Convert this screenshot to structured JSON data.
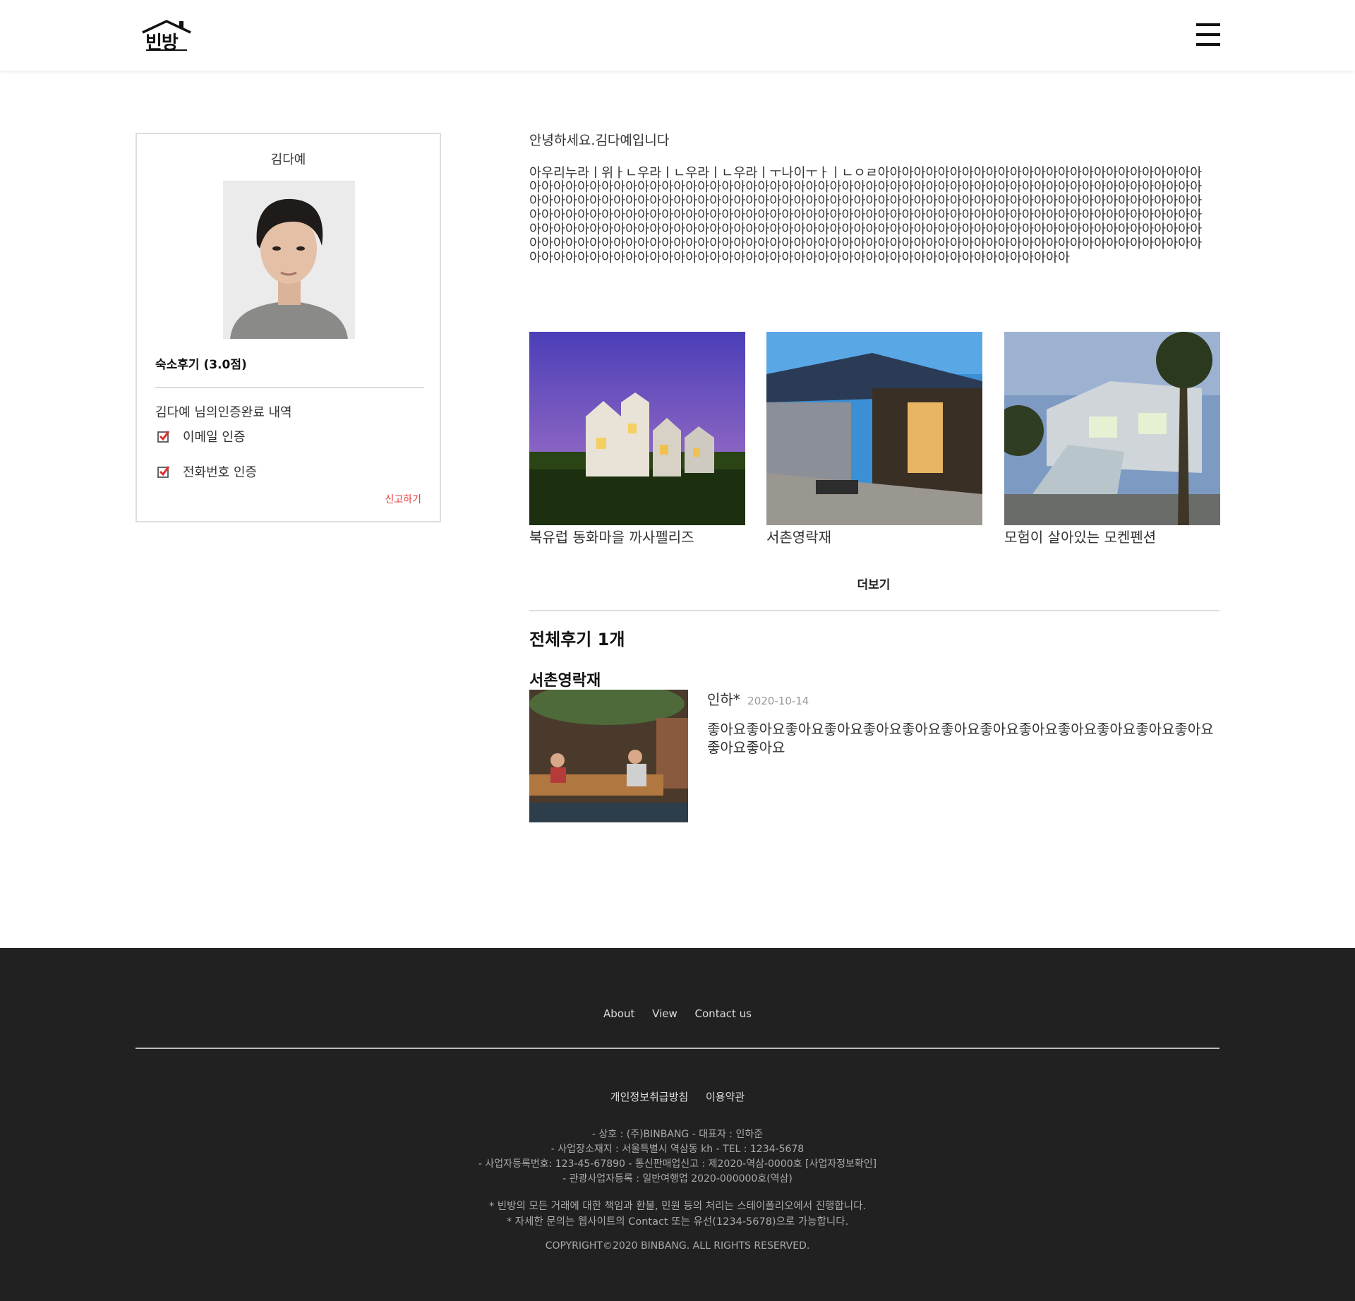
{
  "header": {
    "logo_text": "빈방"
  },
  "profile": {
    "name": "김다예",
    "review_score": "숙소후기 (3.0점)",
    "verify_title": "김다예 님의인증완료 내역",
    "verifications": [
      {
        "label": "이메일 인증",
        "icon": "checkbox-checked-icon"
      },
      {
        "label": "전화번호 인증",
        "icon": "checkbox-checked-icon"
      }
    ],
    "report_label": "신고하기"
  },
  "intro": {
    "greeting": "안녕하세요.김다예입니다",
    "body": "아우리누라ㅣ위ㅏㄴ우라ㅣㄴ우라ㅣㄴ우라ㅣㅜ나이ㅜㅏㅣㄴㅇㄹ아아아아아아아아아아아아아아아아아아아아아아아아아아아아아아아아아아아아아아아아아아아아아아아아아아아아아아아아아아아아아아아아아아아아아아아아아아아아아아아아아아아아아아아아아아아아아아아아아아아아아아아아아아아아아아아아아아아아아아아아아아아아아아아아아아아아아아아아아아아아아아아아아아아아아아아아아아아아아아아아아아아아아아아아아아아아아아아아아아아아아아아아아아아아아아아아아아아아아아아아아아아아아아아아아아아아아아아아아아아아아아아아아아아아아아아아아아아아아아아아아아아아아아아아아아아아아아아아아아아아아아아아아아아아아아아아아아아아아아아아아아아아아아아아아아아아아아아아아아아아아아아아아아아아아아아아아아아아아아아아아아아아아아아아아아아아아아아아아아아아아아아아아아아아아아아아"
  },
  "listings": [
    {
      "title": "북유럽 동화마을 까사펠리즈"
    },
    {
      "title": "서촌영락재"
    },
    {
      "title": "모험이 살아있는 모켄펜션"
    }
  ],
  "more_label": "더보기",
  "reviews": {
    "total_label": "전체후기 1개",
    "items": [
      {
        "place": "서촌영락재",
        "author": "인하*",
        "date": "2020-10-14",
        "text": "좋아요좋아요좋아요좋아요좋아요좋아요좋아요좋아요좋아요좋아요좋아요좋아요좋아요좋아요좋아요"
      }
    ]
  },
  "footer": {
    "nav": [
      "About",
      "View",
      "Contact us"
    ],
    "links": [
      "개인정보취급방침",
      "이용약관"
    ],
    "info": [
      "- 상호 : (주)BINBANG - 대표자 : 인하준",
      "- 사업장소재지 : 서울특별시 역삼동 kh - TEL : 1234-5678",
      "- 사업자등록번호: 123-45-67890 - 통신판매업신고 : 제2020-역삼-0000호 [사업자정보확인]",
      "- 관광사업자등록 : 일반여행업 2020-000000호(역삼)"
    ],
    "notes": [
      "* 빈방의 모든 거래에 대한 책임과 환불, 민원 등의 처리는 스테이폴리오에서 진행합니다.",
      "* 자세한 문의는 웹사이트의 Contact 또는 유선(1234-5678)으로 가능합니다."
    ],
    "copyright": "COPYRIGHT©2020 BINBANG. ALL RIGHTS RESERVED."
  }
}
